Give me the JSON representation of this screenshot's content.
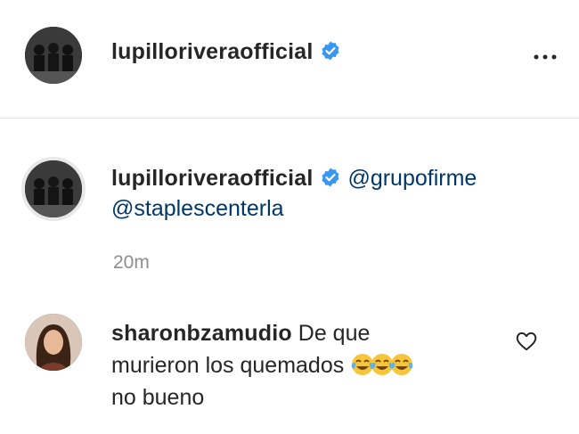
{
  "post": {
    "author": "lupilloriveraofficial",
    "more_icon": "more-horizontal-icon"
  },
  "caption": {
    "author": "lupilloriveraofficial",
    "mention_1": "@grupofirme",
    "mention_2": "@staplescenterla",
    "time": "20m"
  },
  "comment": {
    "author": "sharonbzamudio",
    "text_1": "De que",
    "text_2": "murieron los quemados",
    "emoji": "😂😂😂",
    "text_3": "no bueno",
    "like_icon": "heart-outline-icon"
  },
  "colors": {
    "text": "#262626",
    "mention": "#00376b",
    "muted": "#8e8e8e",
    "verified": "#3897f0",
    "divider": "#e2e2e2"
  }
}
